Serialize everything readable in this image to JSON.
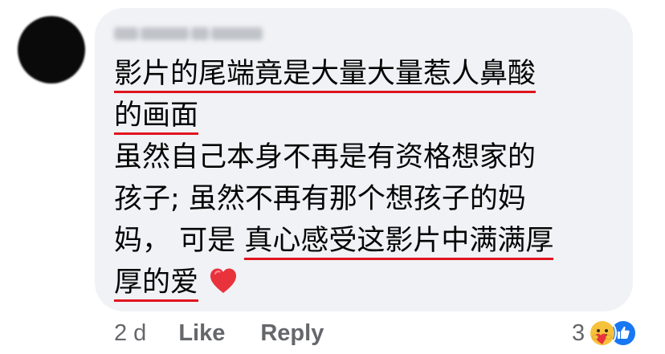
{
  "comment": {
    "lines": [
      "影片的尾端竟是大量大量惹人鼻酸",
      "的画面",
      "虽然自己本身不再是有资格想家的",
      "孩子; 虽然不再有那个想孩子的妈",
      "妈，",
      "可是",
      "真心感受这影片中满满厚",
      "厚的爱"
    ]
  },
  "actions": {
    "time": "2 d",
    "like": "Like",
    "reply": "Reply"
  },
  "reactions": {
    "count": "3",
    "icons": [
      "care-reaction-icon",
      "like-reaction-icon"
    ]
  },
  "colors": {
    "bubble": "#f0f2f5",
    "underline": "#e0141e",
    "meta_text": "#65676b",
    "like_blue": "#1877f2",
    "heart_red": "#e8323c"
  }
}
